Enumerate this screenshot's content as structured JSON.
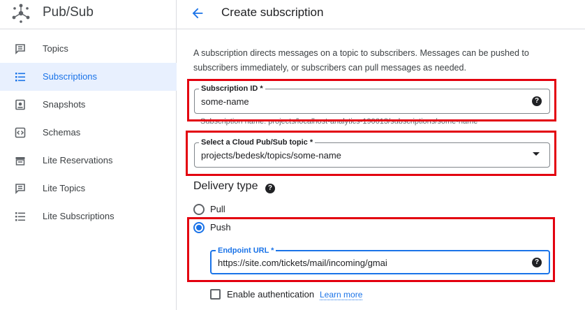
{
  "app": {
    "title": "Pub/Sub"
  },
  "sidebar": {
    "items": [
      {
        "label": "Topics",
        "icon": "message-icon"
      },
      {
        "label": "Subscriptions",
        "icon": "list-icon",
        "active": true
      },
      {
        "label": "Snapshots",
        "icon": "snapshot-icon"
      },
      {
        "label": "Schemas",
        "icon": "code-icon"
      },
      {
        "label": "Lite Reservations",
        "icon": "reservation-icon"
      },
      {
        "label": "Lite Topics",
        "icon": "message-icon"
      },
      {
        "label": "Lite Subscriptions",
        "icon": "list-icon"
      }
    ]
  },
  "header": {
    "title": "Create subscription"
  },
  "form": {
    "intro": "A subscription directs messages on a topic to subscribers. Messages can be pushed to subscribers immediately, or subscribers can pull messages as needed.",
    "subscription_id": {
      "label": "Subscription ID *",
      "value": "some-name",
      "helper": "Subscription name: projects/localhost-analytics-190613/subscriptions/some-name"
    },
    "topic": {
      "label": "Select a Cloud Pub/Sub topic *",
      "value": "projects/bedesk/topics/some-name"
    },
    "delivery": {
      "title": "Delivery type",
      "options": [
        {
          "label": "Pull",
          "checked": false
        },
        {
          "label": "Push",
          "checked": true
        }
      ]
    },
    "endpoint": {
      "label": "Endpoint URL *",
      "value": "https://site.com/tickets/mail/incoming/gmai"
    },
    "auth": {
      "label": "Enable authentication",
      "link": "Learn more"
    }
  },
  "colors": {
    "accent": "#1a73e8",
    "highlight": "#e3000f",
    "active_bg": "#e8f0fe"
  }
}
